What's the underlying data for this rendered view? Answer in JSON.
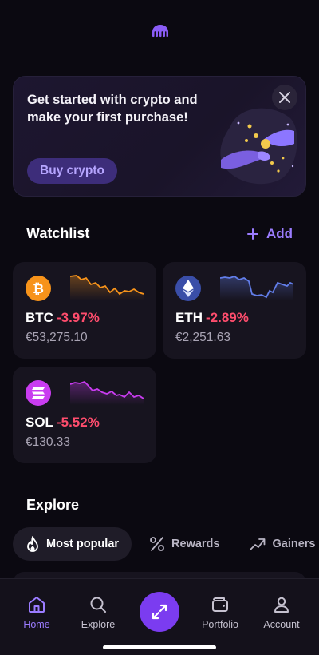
{
  "promo": {
    "title": "Get started with crypto and make your first purchase!",
    "button_label": "Buy crypto"
  },
  "watchlist": {
    "title": "Watchlist",
    "add_label": "Add",
    "coins": [
      {
        "symbol": "BTC",
        "change": "-3.97%",
        "price": "€53,275.10",
        "icon": "bitcoin-icon",
        "color": "#f7931a"
      },
      {
        "symbol": "ETH",
        "change": "-2.89%",
        "price": "€2,251.63",
        "icon": "ethereum-icon",
        "color": "#627eea"
      },
      {
        "symbol": "SOL",
        "change": "-5.52%",
        "price": "€130.33",
        "icon": "solana-icon",
        "color": "#c93cf0"
      }
    ]
  },
  "explore": {
    "title": "Explore",
    "tabs": [
      {
        "label": "Most popular",
        "icon": "flame-icon",
        "active": true
      },
      {
        "label": "Rewards",
        "icon": "percent-icon",
        "active": false
      },
      {
        "label": "Gainers",
        "icon": "trending-up-icon",
        "active": false
      }
    ]
  },
  "nav": {
    "items": [
      {
        "label": "Home",
        "icon": "home-icon",
        "active": true
      },
      {
        "label": "Explore",
        "icon": "search-icon",
        "active": false
      },
      {
        "label": "Portfolio",
        "icon": "wallet-icon",
        "active": false
      },
      {
        "label": "Account",
        "icon": "user-icon",
        "active": false
      }
    ],
    "center_icon": "trade-arrows-icon"
  },
  "colors": {
    "accent": "#9b7cff",
    "negative": "#ff4d6d",
    "background": "#0b0911"
  }
}
